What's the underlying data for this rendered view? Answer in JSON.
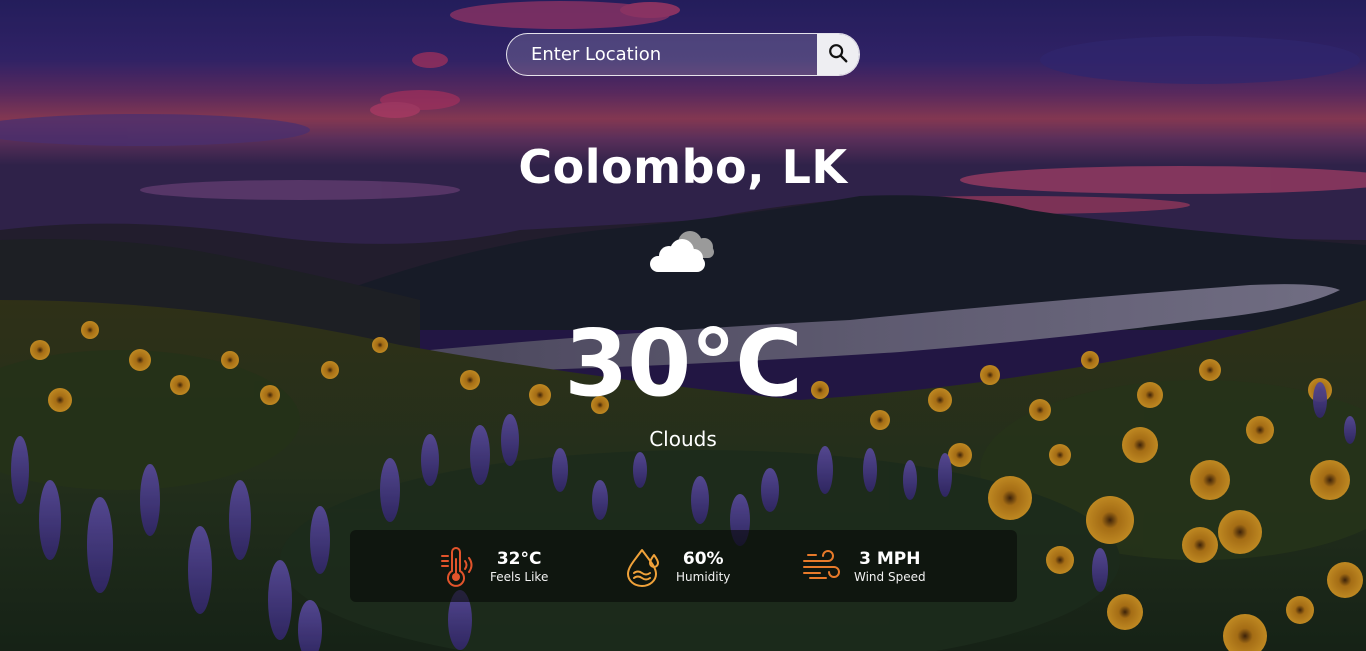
{
  "search": {
    "placeholder": "Enter Location",
    "button_icon": "search-icon"
  },
  "weather": {
    "city": "Colombo, LK",
    "condition_icon": "cloud-icon",
    "temperature": "30°C",
    "condition": "Clouds"
  },
  "details": [
    {
      "icon": "thermometer-icon",
      "value": "32°C",
      "label": "Feels Like",
      "color": "#e2542b"
    },
    {
      "icon": "humidity-icon",
      "value": "60%",
      "label": "Humidity",
      "color": "#f0a23a"
    },
    {
      "icon": "wind-icon",
      "value": "3 MPH",
      "label": "Wind Speed",
      "color": "#e87a2a"
    }
  ],
  "colors": {
    "text": "#ffffff",
    "panel": "#0a0c0a",
    "search_button": "#eeeef2"
  }
}
